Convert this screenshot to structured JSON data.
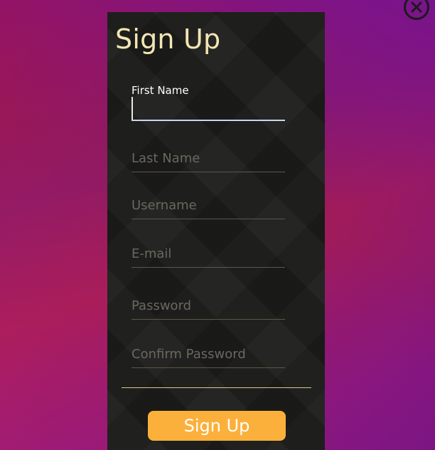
{
  "window": {
    "close_icon": "close-circle-icon"
  },
  "form": {
    "title": "Sign Up",
    "fields": [
      {
        "label": "First Name",
        "placeholder": "",
        "value": "",
        "focused": true
      },
      {
        "label": "",
        "placeholder": "Last Name",
        "value": ""
      },
      {
        "label": "",
        "placeholder": "Username",
        "value": ""
      },
      {
        "label": "",
        "placeholder": "E-mail",
        "value": ""
      },
      {
        "label": "",
        "placeholder": "Password",
        "value": ""
      },
      {
        "label": "",
        "placeholder": "Confirm Password",
        "value": ""
      }
    ],
    "submit_label": "Sign Up"
  },
  "colors": {
    "accent": "#fbb03b",
    "title": "#f2e6b3",
    "panel": "#1c1c1a",
    "focus_underline": "#cdd3f2"
  }
}
